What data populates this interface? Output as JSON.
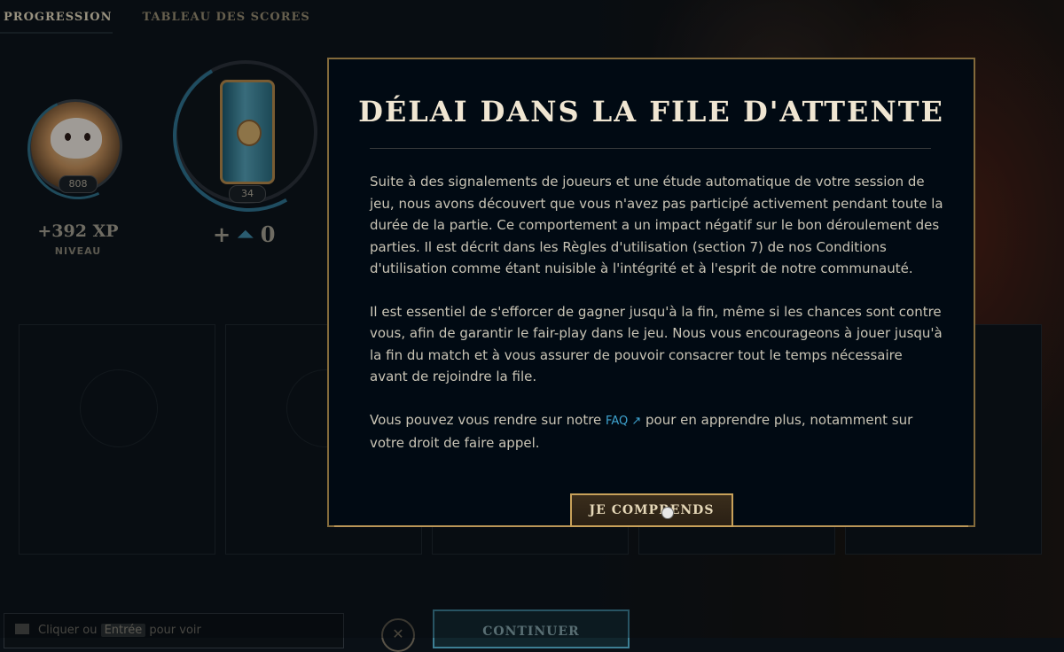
{
  "tabs": [
    {
      "label": "PROGRESSION"
    },
    {
      "label": "TABLEAU DES SCORES"
    }
  ],
  "progression": {
    "level": "808",
    "xp_gain": "+392 XP",
    "xp_label": "NIVEAU",
    "pass_level": "34",
    "points_prefix": "+",
    "points_value": "0"
  },
  "modal": {
    "title": "DÉLAI DANS LA FILE D'ATTENTE",
    "paragraph1": "Suite à des signalements de joueurs et une étude automatique de votre session de jeu, nous avons découvert que vous n'avez pas participé activement pendant toute la durée de la partie. Ce comportement a un impact négatif sur le bon déroulement des parties. Il est décrit dans les Règles d'utilisation (section 7) de nos Conditions d'utilisation comme étant nuisible à l'intégrité et à l'esprit de notre communauté.",
    "paragraph2": "Il est essentiel de s'efforcer de gagner jusqu'à la fin, même si les chances sont contre vous, afin de garantir le fair-play dans le jeu. Nous vous encourageons à jouer jusqu'à la fin du match et à vous assurer de pouvoir consacrer tout le temps nécessaire avant de rejoindre la file.",
    "p3_before": "Vous pouvez vous rendre sur notre ",
    "faq_link": "FAQ ↗",
    "p3_after": " pour en apprendre plus, notamment sur votre droit de faire appel.",
    "button": "JE COMPRENDS"
  },
  "bottom": {
    "chat_before": "Cliquer ou ",
    "chat_key": "Entrée",
    "chat_after": " pour voir",
    "close_symbol": "✕",
    "continue": "CONTINUER"
  },
  "colors": {
    "gold_border": "#c8a15a",
    "accent_blue": "#3fa4d1",
    "modal_bg": "#010a13"
  }
}
